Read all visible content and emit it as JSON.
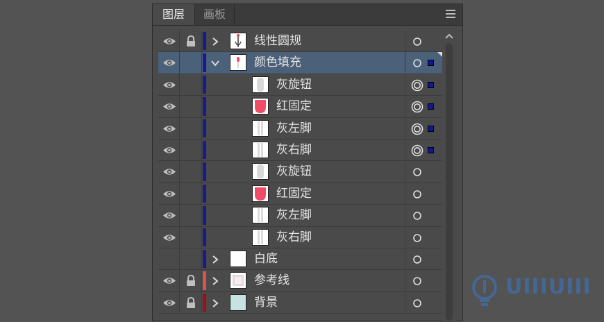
{
  "tabs": [
    {
      "label": "图层",
      "active": true
    },
    {
      "label": "画板",
      "active": false
    }
  ],
  "layers": [
    {
      "name": "线性圆规",
      "visible": true,
      "locked": true,
      "color": "#1a1a8e",
      "expandable": true,
      "expanded": false,
      "indent": 0,
      "thumb": "compass",
      "target": "single",
      "selected": false,
      "sel_square": false
    },
    {
      "name": "颜色填充",
      "visible": true,
      "locked": false,
      "color": "#1a1a8e",
      "expandable": true,
      "expanded": true,
      "indent": 0,
      "thumb": "pin",
      "target": "single",
      "selected": true,
      "sel_square": true
    },
    {
      "name": "灰旋钮",
      "visible": true,
      "locked": false,
      "color": "#1a1a8e",
      "expandable": false,
      "expanded": false,
      "indent": 1,
      "thumb": "gray",
      "target": "double",
      "selected": false,
      "sel_square": true
    },
    {
      "name": "红固定",
      "visible": true,
      "locked": false,
      "color": "#1a1a8e",
      "expandable": false,
      "expanded": false,
      "indent": 1,
      "thumb": "red",
      "target": "double",
      "selected": false,
      "sel_square": true
    },
    {
      "name": "灰左脚",
      "visible": true,
      "locked": false,
      "color": "#1a1a8e",
      "expandable": false,
      "expanded": false,
      "indent": 1,
      "thumb": "leg",
      "target": "double",
      "selected": false,
      "sel_square": true
    },
    {
      "name": "灰右脚",
      "visible": true,
      "locked": false,
      "color": "#1a1a8e",
      "expandable": false,
      "expanded": false,
      "indent": 1,
      "thumb": "leg",
      "target": "double",
      "selected": false,
      "sel_square": true
    },
    {
      "name": "灰旋钮",
      "visible": true,
      "locked": false,
      "color": "#1a1a8e",
      "expandable": false,
      "expanded": false,
      "indent": 1,
      "thumb": "gray",
      "target": "single",
      "selected": false,
      "sel_square": false
    },
    {
      "name": "红固定",
      "visible": true,
      "locked": false,
      "color": "#1a1a8e",
      "expandable": false,
      "expanded": false,
      "indent": 1,
      "thumb": "red",
      "target": "single",
      "selected": false,
      "sel_square": false
    },
    {
      "name": "灰左脚",
      "visible": true,
      "locked": false,
      "color": "#1a1a8e",
      "expandable": false,
      "expanded": false,
      "indent": 1,
      "thumb": "leg",
      "target": "single",
      "selected": false,
      "sel_square": false
    },
    {
      "name": "灰右脚",
      "visible": true,
      "locked": false,
      "color": "#1a1a8e",
      "expandable": false,
      "expanded": false,
      "indent": 1,
      "thumb": "leg",
      "target": "single",
      "selected": false,
      "sel_square": false
    },
    {
      "name": "白底",
      "visible": false,
      "locked": false,
      "color": "#1a1a8e",
      "expandable": true,
      "expanded": false,
      "indent": 0,
      "thumb": "white",
      "target": "single",
      "selected": false,
      "sel_square": false
    },
    {
      "name": "参考线",
      "visible": true,
      "locked": true,
      "color": "#d9534f",
      "expandable": true,
      "expanded": false,
      "indent": 0,
      "thumb": "guide",
      "target": "single",
      "selected": false,
      "sel_square": false
    },
    {
      "name": "背景",
      "visible": true,
      "locked": true,
      "color": "#a01010",
      "expandable": true,
      "expanded": false,
      "indent": 0,
      "thumb": "bg",
      "target": "single",
      "selected": false,
      "sel_square": false
    }
  ],
  "watermark": {
    "text": "UIIIUIII"
  }
}
